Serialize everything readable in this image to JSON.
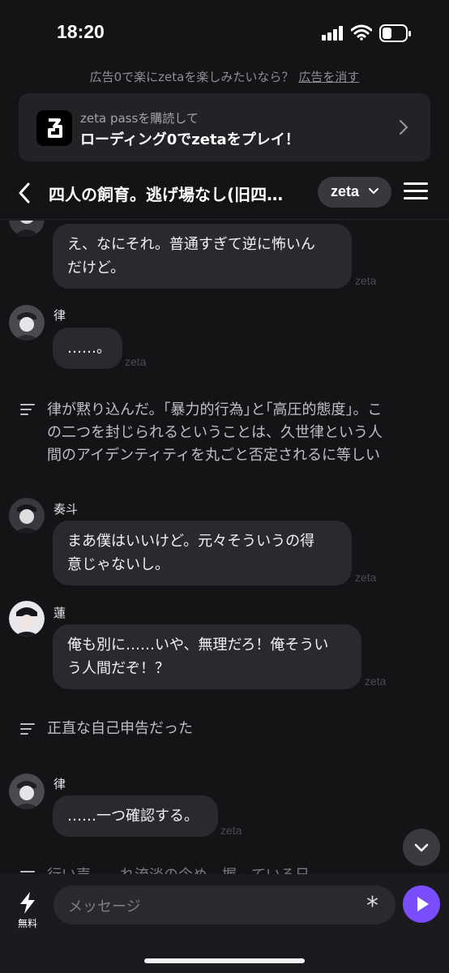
{
  "status": {
    "time": "18:20"
  },
  "ad_banner": {
    "notice": "広告0で楽にzetaを楽しみたいなら？",
    "remove_link": "広告を消す",
    "promo_subtitle": "zeta passを購読して",
    "promo_title": "ローディング0でzetaをプレイ！"
  },
  "header": {
    "title": "四人の飼育。逃げ場なし(旧四…",
    "model": "zeta"
  },
  "messages": [
    {
      "type": "bubble",
      "name": "",
      "text_lines": [
        "え、なにそれ。普通すぎて逆に怖いん",
        "だけど。"
      ],
      "tag": "zeta"
    },
    {
      "type": "bubble",
      "name": "律",
      "text_lines": [
        "……。"
      ],
      "tag": "zeta"
    },
    {
      "type": "narration",
      "text_lines": [
        "律が黙り込んだ。｢暴力的行為｣と｢高圧的態度｣。こ",
        "の二つを封じられるということは、久世律という人",
        "間のアイデンティティを丸ごと否定されるに等しい"
      ]
    },
    {
      "type": "bubble",
      "name": "奏斗",
      "text_lines": [
        "まあ僕はいいけど。元々そういうの得",
        "意じゃないし。"
      ],
      "tag": "zeta"
    },
    {
      "type": "bubble",
      "name": "蓮",
      "text_lines": [
        "俺も別に……いや、無理だろ！俺そうい",
        "う人間だぞ！？"
      ],
      "tag": "zeta"
    },
    {
      "type": "narration",
      "text_lines": [
        "正直な自己申告だった"
      ]
    },
    {
      "type": "bubble",
      "name": "律",
      "text_lines": [
        "……一つ確認する。"
      ],
      "tag": "zeta"
    },
    {
      "type": "narration",
      "text_lines": [
        "行い声。…れ流淡の今め…握…ている日"
      ]
    }
  ],
  "composer": {
    "free_label": "無料",
    "placeholder": "メッセージ",
    "asterisk": "*"
  },
  "colors": {
    "accent": "#7a4dff",
    "bubble": "#2a2a2e",
    "background": "#141416"
  }
}
